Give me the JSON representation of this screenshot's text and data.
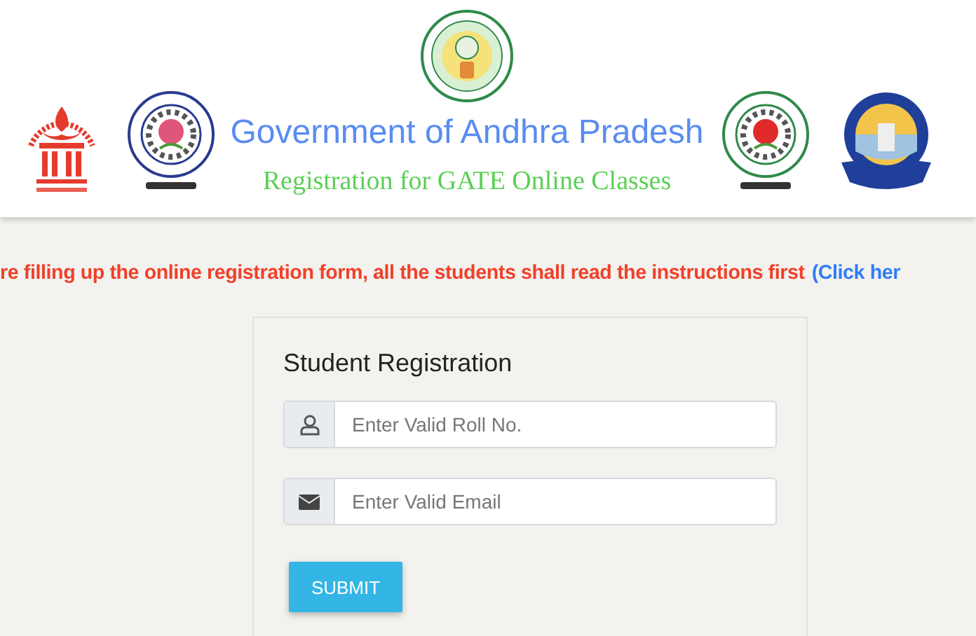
{
  "header": {
    "title": "Government of Andhra Pradesh",
    "subtitle": "Registration for GATE Online Classes"
  },
  "notice": {
    "text": "re filling up the online registration form, all the students shall read the instructions first",
    "link": "(Click her"
  },
  "form": {
    "title": "Student Registration",
    "fields": [
      {
        "kind": "user",
        "placeholder": "Enter Valid Roll No."
      },
      {
        "kind": "email",
        "placeholder": "Enter Valid Email"
      }
    ],
    "submit": "SUBMIT"
  }
}
